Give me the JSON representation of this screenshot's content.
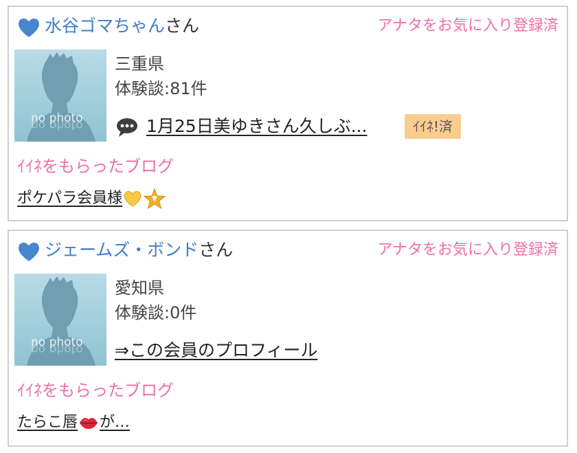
{
  "members": [
    {
      "name": "水谷ゴマちゃん",
      "honorific": "さん",
      "favorite_status": "アナタをお気に入り登録済",
      "avatar_text": "no photo",
      "prefecture": "三重県",
      "experience_label": "体験談:",
      "experience_count": "81",
      "experience_unit": "件",
      "recent_blog_title": "1月25日美ゆきさん久しぶ...",
      "liked_badge": "ｲｲﾈ!済",
      "liked_blogs_label": "ｲｲﾈをもらったブログ",
      "liked_blog": {
        "text_before": "ポケパラ会員様",
        "text_after": "",
        "emoji": [
          "yellow-heart-icon",
          "star-badge-icon"
        ]
      }
    },
    {
      "name": "ジェームズ・ボンド",
      "honorific": "さん",
      "favorite_status": "アナタをお気に入り登録済",
      "avatar_text": "no photo",
      "prefecture": "愛知県",
      "experience_label": "体験談:",
      "experience_count": "0",
      "experience_unit": "件",
      "profile_link": "⇒この会員のプロフィール",
      "liked_blogs_label": "ｲｲﾈをもらったブログ",
      "liked_blog": {
        "text_before": "たらこ唇",
        "text_after": "が…",
        "emoji": [
          "lips-icon"
        ]
      }
    }
  ],
  "colors": {
    "name_blue": "#3f7ec7",
    "accent_pink": "#ee6ea8",
    "badge_orange": "#f9cc8f",
    "border_gray": "#cfcfcf"
  }
}
